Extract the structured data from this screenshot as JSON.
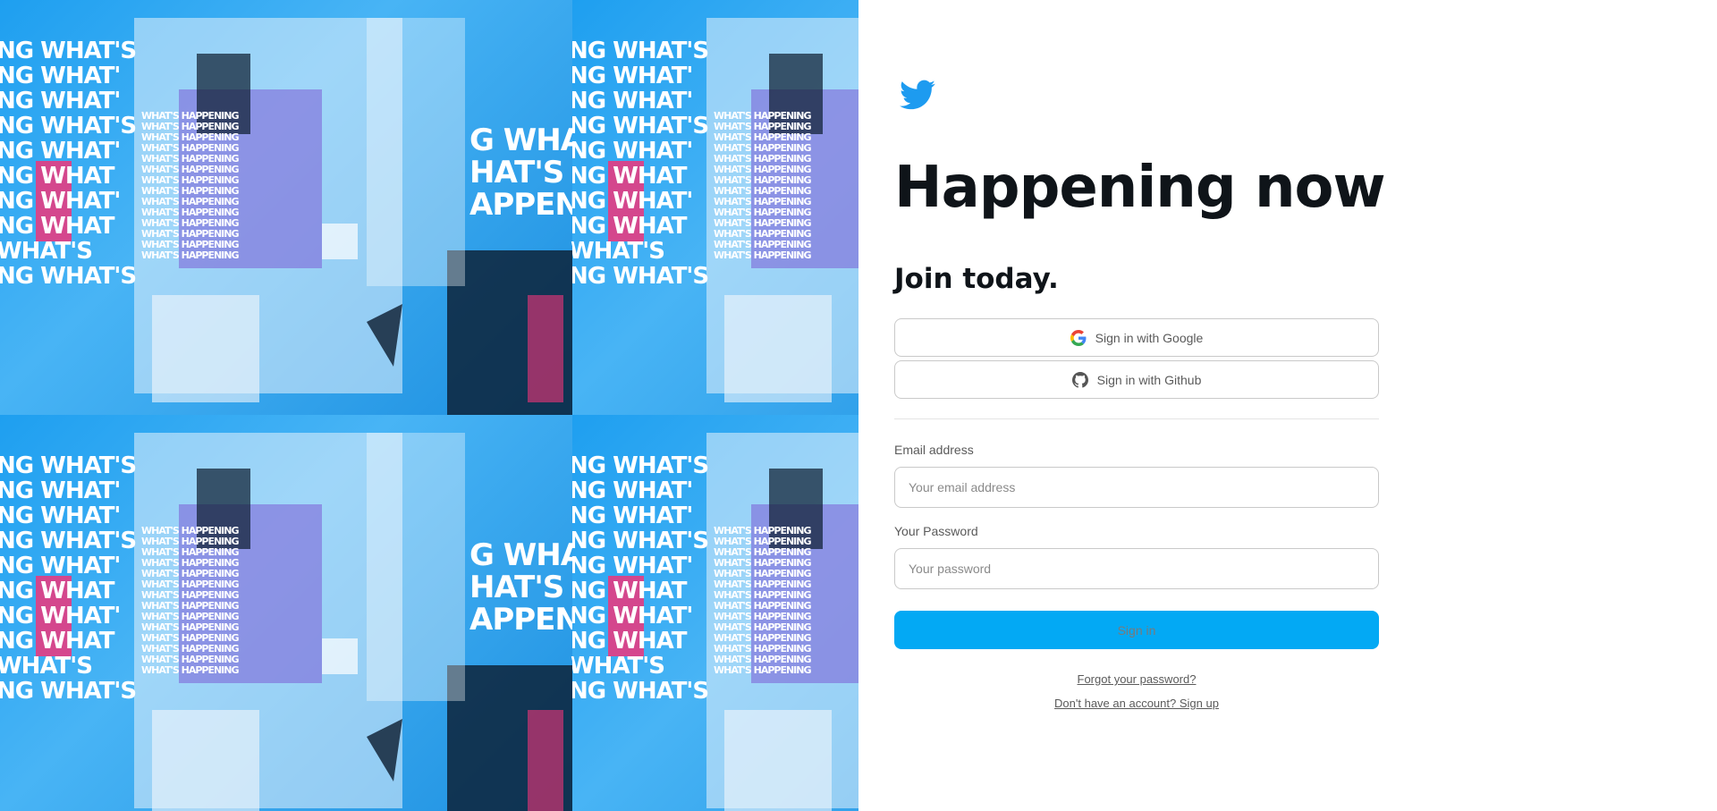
{
  "hero": {
    "big_stack": [
      "NG WHAT'S",
      "NG WHAT'",
      "NG WHAT'",
      "NG WHAT'S",
      "NG WHAT'",
      "NG WHAT",
      "NG WHAT'",
      "NG WHAT",
      "WHAT'S",
      "NG WHAT'S"
    ],
    "small_stack": [
      "WHAT'S HAPPENING",
      "WHAT'S HAPPENING",
      "WHAT'S HAPPENING",
      "WHAT'S HAPPENING",
      "WHAT'S HAPPENING",
      "WHAT'S HAPPENING",
      "WHAT'S HAPPENING",
      "WHAT'S HAPPENING",
      "WHAT'S HAPPENING",
      "WHAT'S HAPPENING",
      "WHAT'S HAPPENING",
      "WHAT'S HAPPENING",
      "WHAT'S HAPPENING",
      "WHAT'S HAPPENING"
    ],
    "mid_stack": [
      "G WHA",
      "HAT'S HA",
      "APPENI"
    ],
    "colors": {
      "blue": "#1da1f2",
      "purple": "#7b5cd6",
      "pink": "#f0357a",
      "navy": "#0b1b2e"
    }
  },
  "logo": {
    "icon": "twitter-bird-icon",
    "color": "#1d9bf0"
  },
  "headline": "Happening now",
  "subhead": "Join today.",
  "oauth": {
    "google": {
      "label": "Sign in with Google",
      "icon": "google-icon"
    },
    "github": {
      "label": "Sign in with Github",
      "icon": "github-icon"
    }
  },
  "form": {
    "email_label": "Email address",
    "email_placeholder": "Your email address",
    "email_value": "",
    "password_label": "Your Password",
    "password_placeholder": "Your password",
    "password_value": "",
    "submit_label": "Sign in",
    "accent": "#03a9f4"
  },
  "links": {
    "forgot": "Forgot your password?",
    "signup": "Don't have an account? Sign up"
  }
}
